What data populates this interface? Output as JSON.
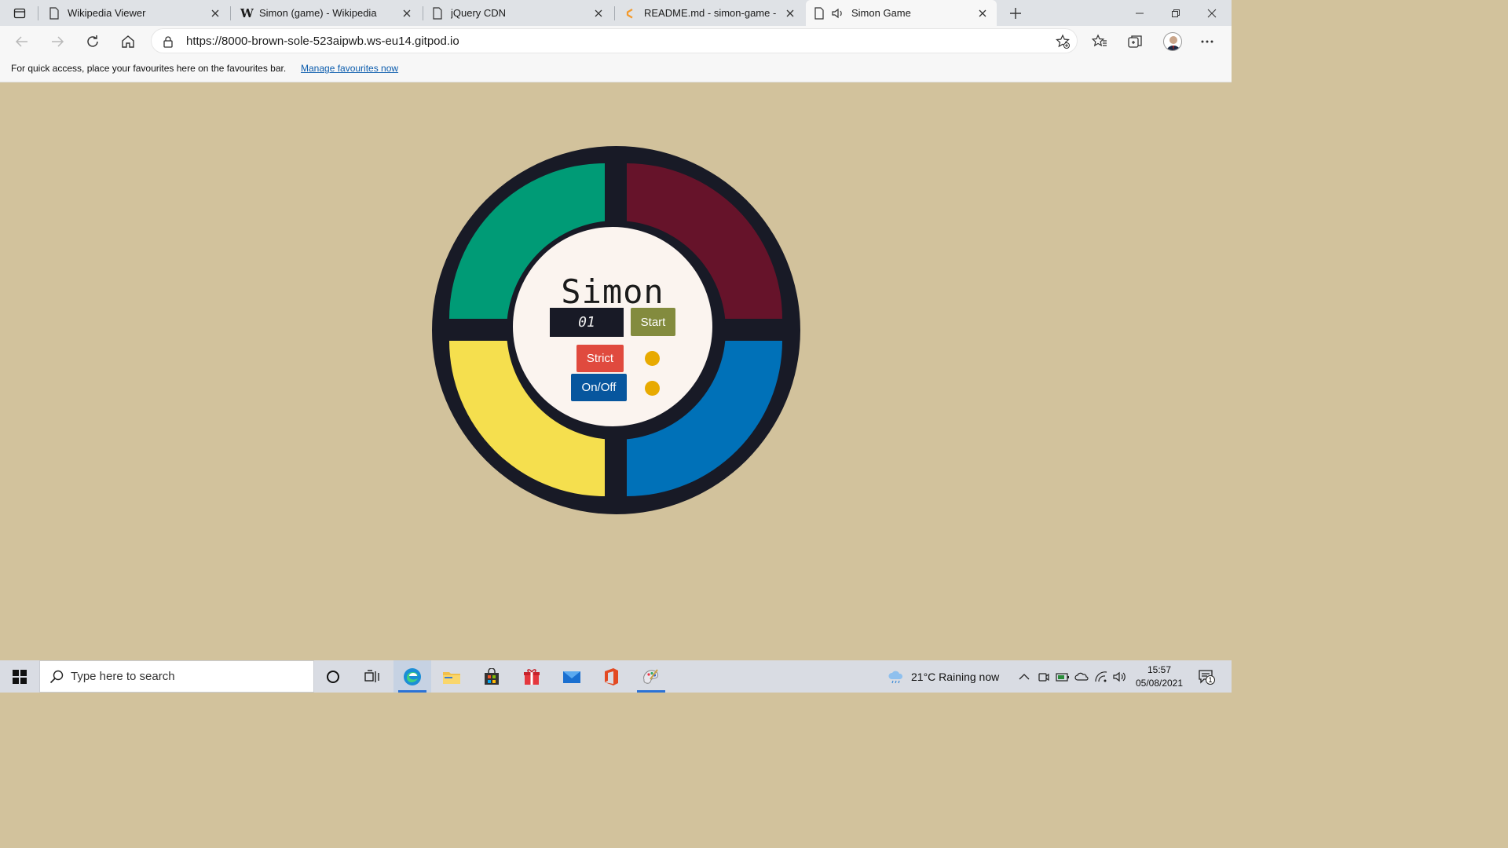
{
  "browser": {
    "tabs": [
      {
        "title": "Wikipedia Viewer",
        "icon": "page-icon"
      },
      {
        "title": "Simon (game) - Wikipedia",
        "icon": "wikipedia-icon"
      },
      {
        "title": "jQuery CDN",
        "icon": "page-icon"
      },
      {
        "title": "README.md - simon-game - Git",
        "icon": "gitpod-icon"
      },
      {
        "title": "Simon Game",
        "icon": "page-icon",
        "active": true,
        "audio": true
      }
    ],
    "url": "https://8000-brown-sole-523aipwb.ws-eu14.gitpod.io",
    "favourites_bar": {
      "message": "For quick access, place your favourites here on the favourites bar.",
      "link": "Manage favourites now"
    }
  },
  "game": {
    "title": "Simon",
    "count": "01",
    "start_label": "Start",
    "strict_label": "Strict",
    "onoff_label": "On/Off",
    "colors": {
      "green": "#009b76",
      "red": "#66132a",
      "yellow": "#f5df4e",
      "blue": "#0071b8",
      "led": "#e8aa00",
      "page_bg": "#d2c29c"
    }
  },
  "taskbar": {
    "search_placeholder": "Type here to search",
    "weather": "21°C  Raining now",
    "time": "15:57",
    "date": "05/08/2021",
    "notifications": "1"
  }
}
